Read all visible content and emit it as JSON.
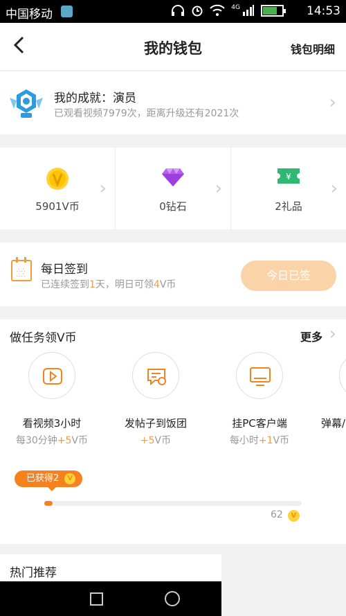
{
  "status_bar": {
    "carrier": "中国移动",
    "network": "4G",
    "time": "14:53"
  },
  "header": {
    "back_icon": "back-arrow-icon",
    "title": "我的钱包",
    "detail_link": "钱包明细"
  },
  "achievement": {
    "title": "我的成就：演员",
    "subtitle": "已观看视频7979次，距离升级还有2021次"
  },
  "assets": [
    {
      "icon": "v-coin-icon",
      "value": "5901V币"
    },
    {
      "icon": "diamond-icon",
      "value": "0钻石"
    },
    {
      "icon": "gift-ticket-icon",
      "value": "2礼品"
    }
  ],
  "daily_signin": {
    "title": "每日签到",
    "subtitle_parts": [
      "已连续签到",
      "1",
      "天，明日可领",
      "4",
      "V币"
    ],
    "button": "今日已签"
  },
  "tasks": {
    "title": "做任务领V币",
    "more": "更多",
    "items": [
      {
        "icon": "play-video-icon",
        "name": "看视频3小时",
        "sub_pre": "每30分钟",
        "sub_hl": "+5",
        "sub_post": "V币"
      },
      {
        "icon": "post-chat-icon",
        "name": "发帖子到饭团",
        "sub_pre": "",
        "sub_hl": "+5",
        "sub_post": "V币"
      },
      {
        "icon": "monitor-icon",
        "name": "挂PC客户端",
        "sub_pre": "每小时",
        "sub_hl": "+1",
        "sub_post": "V币"
      },
      {
        "icon": "danmaku-icon",
        "name": "弹幕/",
        "sub_pre": "",
        "sub_hl": "",
        "sub_post": ""
      }
    ],
    "progress": {
      "earned_label": "已获得2",
      "coin_symbol": "V",
      "earned": 2,
      "goal": 62,
      "goal_label": "62"
    }
  },
  "hot": {
    "title": "热门推荐"
  }
}
